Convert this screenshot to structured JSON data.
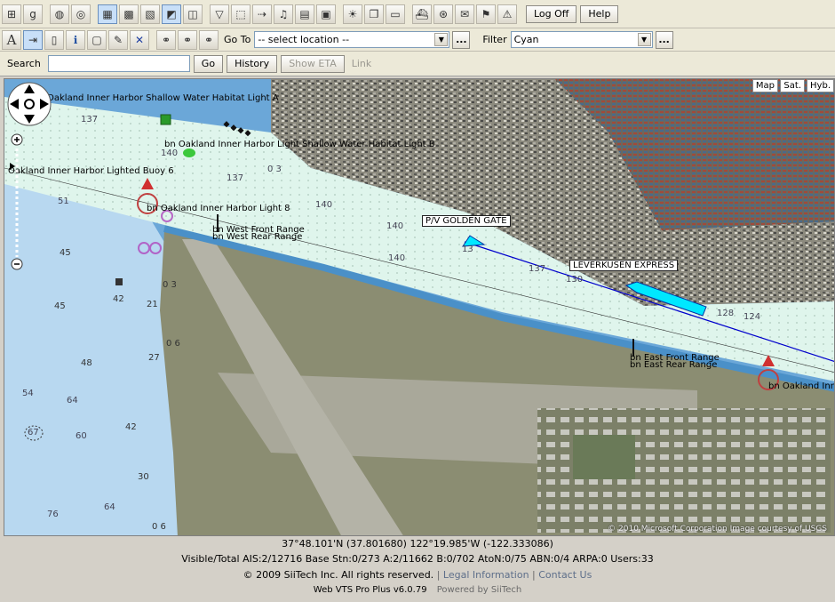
{
  "toolbar": {
    "logoff_label": "Log Off",
    "help_label": "Help",
    "goto_label": "Go To",
    "goto_value": "-- select location --",
    "goto_more": "...",
    "filter_label": "Filter",
    "filter_value": "Cyan",
    "filter_more": "...",
    "search_label": "Search",
    "search_value": "",
    "go_label": "Go",
    "history_label": "History",
    "show_eta_label": "Show ETA",
    "link_label": "Link"
  },
  "map": {
    "type_buttons": [
      "Map",
      "Sat.",
      "Hyb."
    ],
    "labels": {
      "shallow_light_a": "Oakland Inner Harbor Shallow Water Habitat Light A",
      "shallow_light_b": "bn Oakland Inner Harbor Light Shallow Water Habitat Light B",
      "buoy6": "Oakland Inner Harbor Lighted Buoy 6",
      "light8": "bn Oakland Inner Harbor Light 8",
      "west_front": "bn West Front Range",
      "west_rear": "bn West Rear Range",
      "east_front": "bn East Front Range",
      "east_rear": "bn East Rear Range",
      "oakland_inn": "bn Oakland Inn"
    },
    "ships": {
      "golden_gate": "P/V GOLDEN GATE",
      "leverkusen": "LEVERKUSEN EXPRESS"
    },
    "soundings": [
      "137",
      "140",
      "0 3",
      "137",
      "140",
      "140",
      "13",
      "137",
      "130",
      "128",
      "124",
      "51",
      "45",
      "42",
      "45",
      "48",
      "21",
      "0 3",
      "0 6",
      "27",
      "54",
      "64",
      "42",
      "60",
      "67",
      "30",
      "76",
      "64",
      "0 6",
      "140"
    ],
    "image_credit": "© 2010 Microsoft Corporation    Image courtesy of USGS"
  },
  "status": {
    "coords": "37°48.101'N (37.801680)    122°19.985'W (-122.333086)",
    "ais": "Visible/Total AIS:2/12716  Base Stn:0/273  A:2/11662  B:0/702  AtoN:0/75  ABN:0/4  ARPA:0  Users:33",
    "copyright": "© 2009 SiiTech Inc. All rights reserved.",
    "legal": "Legal Information",
    "contact": "Contact Us",
    "version": "Web VTS Pro Plus v6.0.79",
    "powered": "Powered by SiiTech"
  },
  "colors": {
    "water": "#6ba7d8",
    "channel": "#dff5ec",
    "land": "#8a8a70",
    "ship": "#00e8ff",
    "route": "#0000cc"
  }
}
